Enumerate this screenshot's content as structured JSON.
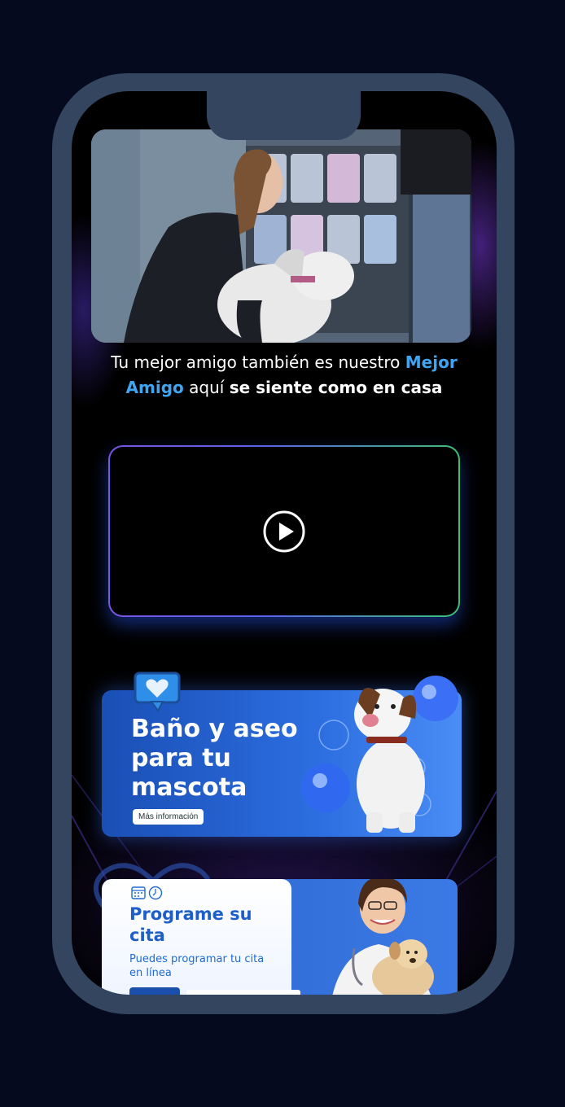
{
  "hero": {
    "image_alt": "Veterinaria acariciando a un perro en una tienda de mascotas"
  },
  "tagline": {
    "part1": "Tu mejor amigo también es nuestro ",
    "accent": "Mejor Amigo",
    "part2": " aquí ",
    "strong": "se siente como en casa"
  },
  "video": {
    "play_icon": "play-icon"
  },
  "bath_card": {
    "title": "Baño y aseo para tu mascota",
    "button_label": "Más información",
    "badge_icon": "heart-chat-icon"
  },
  "appointment_card": {
    "title": "Programe su cita",
    "description": "Puedes programar tu cita en línea",
    "icons": [
      "calendar-icon",
      "clock-icon"
    ]
  },
  "colors": {
    "page_bg": "#050a1e",
    "phone_frame": "#34465f",
    "accent_blue": "#3fa5f0",
    "card_blue": "#2c6ee0"
  }
}
